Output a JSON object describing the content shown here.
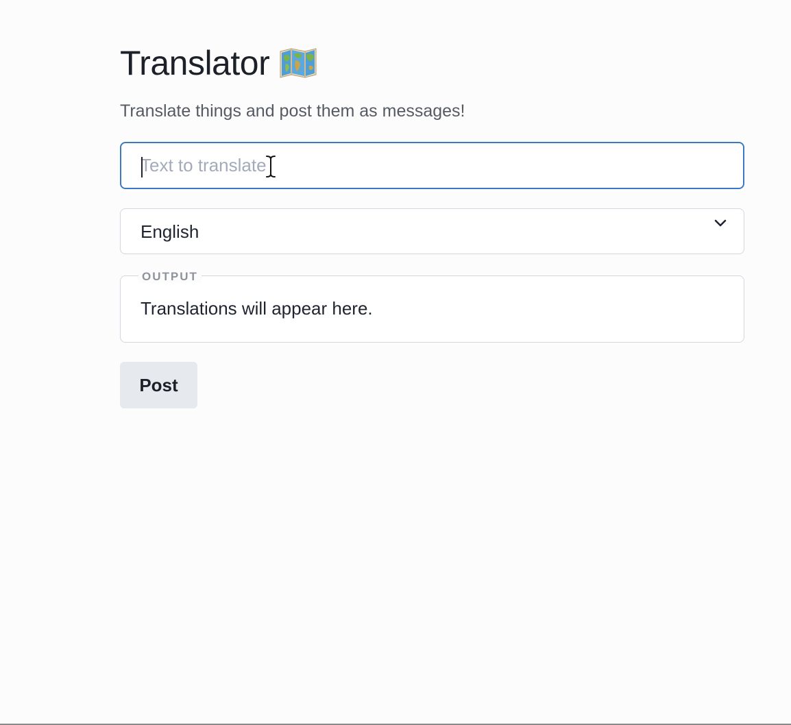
{
  "header": {
    "title": "Translator",
    "icon": "world-map-icon",
    "subtitle": "Translate things and post them as messages!"
  },
  "translate_input": {
    "value": "",
    "placeholder": "Text to translate"
  },
  "language_select": {
    "selected": "English",
    "icon": "chevron-down-icon"
  },
  "output": {
    "legend": "OUTPUT",
    "text": "Translations will appear here."
  },
  "actions": {
    "post_label": "Post"
  },
  "colors": {
    "focus_border": "#3b78c4",
    "button_bg": "#e6e9ee",
    "placeholder": "#a3abbb"
  }
}
